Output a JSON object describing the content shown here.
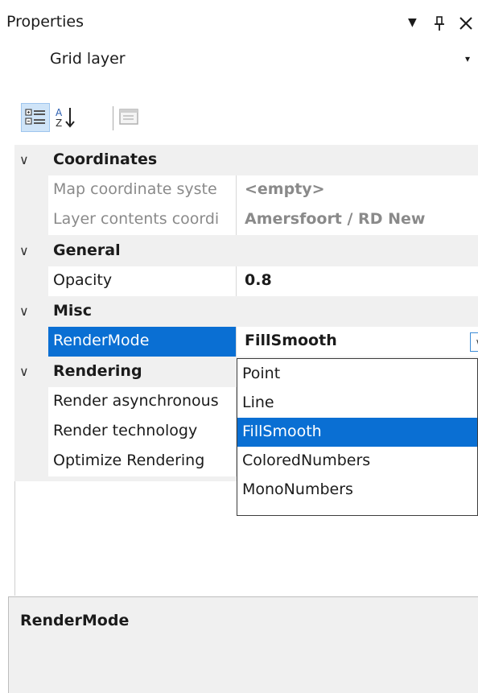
{
  "panel": {
    "title": "Properties",
    "icons": [
      "dropdown-triangle-icon",
      "pin-icon",
      "close-icon"
    ],
    "pin_glyph": "ı",
    "close_glyph": "×",
    "dropdown_glyph": "▼"
  },
  "object_selector": {
    "value": "Grid layer",
    "arrow": "▾"
  },
  "toolbar": {
    "buttons": [
      {
        "name": "categorized-view",
        "icon": "categorized-icon",
        "active": true
      },
      {
        "name": "alphabetical-view",
        "icon": "sort-az-icon",
        "active": false
      },
      {
        "name": "property-pages",
        "icon": "property-pages-icon",
        "active": false
      }
    ],
    "sort_az_text": "A↓",
    "sort_z_text": "Z"
  },
  "grid": {
    "chevron": "∨",
    "categories": [
      {
        "name": "Coordinates",
        "properties": [
          {
            "label": "Map coordinate syste",
            "value": "<empty>",
            "readonly": true
          },
          {
            "label": "Layer contents coordi",
            "value": "Amersfoort / RD New",
            "readonly": true
          }
        ]
      },
      {
        "name": "General",
        "properties": [
          {
            "label": "Opacity",
            "value": "0.8",
            "readonly": false
          }
        ]
      },
      {
        "name": "Misc",
        "properties": [
          {
            "label": "RenderMode",
            "value": "FillSmooth",
            "readonly": false,
            "selected": true
          }
        ]
      },
      {
        "name": "Rendering",
        "properties": [
          {
            "label": "Render asynchronous",
            "value": "",
            "readonly": false
          },
          {
            "label": "Render technology",
            "value": "",
            "readonly": false
          },
          {
            "label": "Optimize Rendering",
            "value": "",
            "readonly": false
          }
        ]
      }
    ],
    "dropdown_button_glyph": "∨"
  },
  "dropdown": {
    "options": [
      "Point",
      "Line",
      "FillSmooth",
      "ColoredNumbers",
      "MonoNumbers"
    ],
    "selected": "FillSmooth"
  },
  "description": {
    "title": "RenderMode"
  },
  "colors": {
    "accent": "#0a6fd3",
    "category_bg": "#f0f0f0",
    "readonly_text": "#8a8a8a"
  }
}
